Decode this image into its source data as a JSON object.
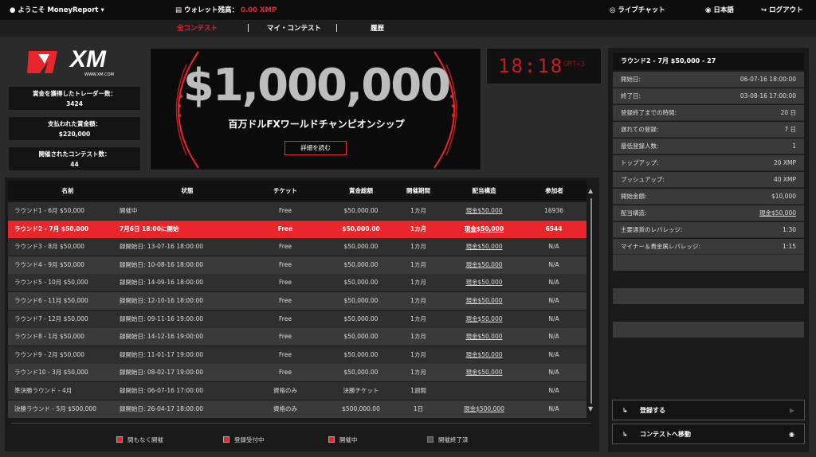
{
  "topbar": {
    "welcome": "ようこそ MoneyReport",
    "wallet_label": "ウォレット残高：",
    "wallet_value": "0.00 XMP",
    "live_chat": "ライブチャット",
    "language": "日本語",
    "logout": "ログアウト"
  },
  "tabs": [
    "全コンテスト",
    "マイ・コンテスト",
    "履歴"
  ],
  "logo": {
    "text": "XM",
    "sub": "WWW.XM.COM"
  },
  "stats": [
    {
      "label": "賞金を獲得したトレーダー数：",
      "value": "3424"
    },
    {
      "label": "支払われた賞金額：",
      "value": "$220,000"
    },
    {
      "label": "開催されたコンテスト数：",
      "value": "44"
    }
  ],
  "banner": {
    "amount": "$1,000,000",
    "subtitle": "百万ドルFXワールドチャンピオンシップ",
    "button": "詳細を読む"
  },
  "clock": {
    "time": "18:18",
    "zone": "GMT+3"
  },
  "table": {
    "headers": [
      "名前",
      "状態",
      "チケット",
      "賞金総額",
      "開催期間",
      "配当構造",
      "参加者"
    ],
    "rows": [
      [
        "ラウンド1 - 6月 $50,000",
        "開催中",
        "Free",
        "$50,000.00",
        "1カ月",
        "現金$50,000",
        "16936"
      ],
      [
        "ラウンド2 - 7月 $50,000",
        "7月6日 18:00に開始",
        "Free",
        "$50,000.00",
        "1カ月",
        "現金$50,000",
        "6544"
      ],
      [
        "ラウンド3 - 8月 $50,000",
        "録開始日: 13-07-16 18:00:00",
        "Free",
        "$50,000.00",
        "1カ月",
        "現金$50,000",
        "N/A"
      ],
      [
        "ラウンド4 - 9月 $50,000",
        "録開始日: 10-08-16 18:00:00",
        "Free",
        "$50,000.00",
        "1カ月",
        "現金$50,000",
        "N/A"
      ],
      [
        "ラウンド5 - 10月 $50,000",
        "録開始日: 14-09-16 18:00:00",
        "Free",
        "$50,000.00",
        "1カ月",
        "現金$50,000",
        "N/A"
      ],
      [
        "ラウンド6 - 11月 $50,000",
        "録開始日: 12-10-16 18:00:00",
        "Free",
        "$50,000.00",
        "1カ月",
        "現金$50,000",
        "N/A"
      ],
      [
        "ラウンド7 - 12月 $50,000",
        "録開始日: 09-11-16 19:00:00",
        "Free",
        "$50,000.00",
        "1カ月",
        "現金$50,000",
        "N/A"
      ],
      [
        "ラウンド8 - 1月 $50,000",
        "録開始日: 14-12-16 19:00:00",
        "Free",
        "$50,000.00",
        "1カ月",
        "現金$50,000",
        "N/A"
      ],
      [
        "ラウンド9 - 2月 $50,000",
        "録開始日: 11-01-17 19:00:00",
        "Free",
        "$50,000.00",
        "1カ月",
        "現金$50,000",
        "N/A"
      ],
      [
        "ラウンド10 - 3月 $50,000",
        "録開始日: 08-02-17 19:00:00",
        "Free",
        "$50,000.00",
        "1カ月",
        "現金$50,000",
        "N/A"
      ],
      [
        "準決勝ラウンド - 4月",
        "録開始日: 06-07-16 17:00:00",
        "資格のみ",
        "決勝チケット",
        "1週間",
        "",
        "N/A"
      ],
      [
        "決勝ラウンド - 5月 $500,000",
        "録開始日: 26-04-17 18:00:00",
        "資格のみ",
        "$500,000.00",
        "1日",
        "現金$500,000",
        "N/A"
      ]
    ]
  },
  "legend": [
    "間もなく開催",
    "登録受付中",
    "開催中",
    "開催終了済"
  ],
  "detail": {
    "title": "ラウンド2 - 7月 $50,000 - 27",
    "rows": [
      {
        "k": "開始日:",
        "v": "06-07-16 18:00:00"
      },
      {
        "k": "終了日:",
        "v": "03-08-16 17:00:00"
      },
      {
        "k": "登録終了までの時間:",
        "v": "20 日"
      },
      {
        "k": "遅れての登録:",
        "v": "7 日"
      },
      {
        "k": "最低登録人数:",
        "v": "1"
      },
      {
        "k": "トップアップ:",
        "v": "20 XMP"
      },
      {
        "k": "プッシュアップ:",
        "v": "40 XMP"
      },
      {
        "k": "開始金額:",
        "v": "$10,000"
      },
      {
        "k": "配当構造:",
        "v": "現金$50,000"
      },
      {
        "k": "主要通貨のレバレッジ:",
        "v": "1:30"
      },
      {
        "k": "マイナー＆貴金属レバレッジ:",
        "v": "1:15"
      }
    ],
    "register": "登録する",
    "goto": "コンテストへ移動"
  },
  "colors": {
    "accent": "#e8262b",
    "bg": "#2b2b2b"
  }
}
